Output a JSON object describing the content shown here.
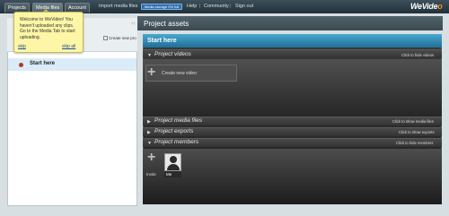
{
  "nav": {
    "tabs": [
      {
        "label": "Projects"
      },
      {
        "label": "Media files"
      },
      {
        "label": "Account"
      }
    ],
    "links": [
      "Import media files",
      "Help",
      "Community",
      "Sign out"
    ],
    "storage": "Media storage 0% full",
    "logo_main": "WeVide",
    "logo_tail": "o"
  },
  "left": {
    "partial_label": "ed",
    "create_project": "Create new pro",
    "project": "Start here"
  },
  "tooltip": {
    "text": "Welcome to WeVideo! You haven't uploaded any clips. Go to the Media Tab to start uploading.",
    "skip": "skip",
    "skip_all": "skip all"
  },
  "right": {
    "collapse": "‹‹",
    "title": "Project assets",
    "panel_title": "Start here",
    "sections": {
      "videos": {
        "label": "Project videos",
        "action": "Click to hide videos"
      },
      "media": {
        "label": "Project media files",
        "action": "Click to show media files"
      },
      "exports": {
        "label": "Project exports",
        "action": "Click to show exports"
      },
      "members": {
        "label": "Project members",
        "action": "Click to hide members"
      }
    },
    "create_video": "Create new video",
    "invite": "Invite",
    "member_me": "Me"
  },
  "colors": {
    "topbar": "#2d3c45",
    "accent_blue": "#2f8fbf",
    "logo_tail": "#ff8a1a",
    "tooltip_bg": "#fdf6a6"
  }
}
